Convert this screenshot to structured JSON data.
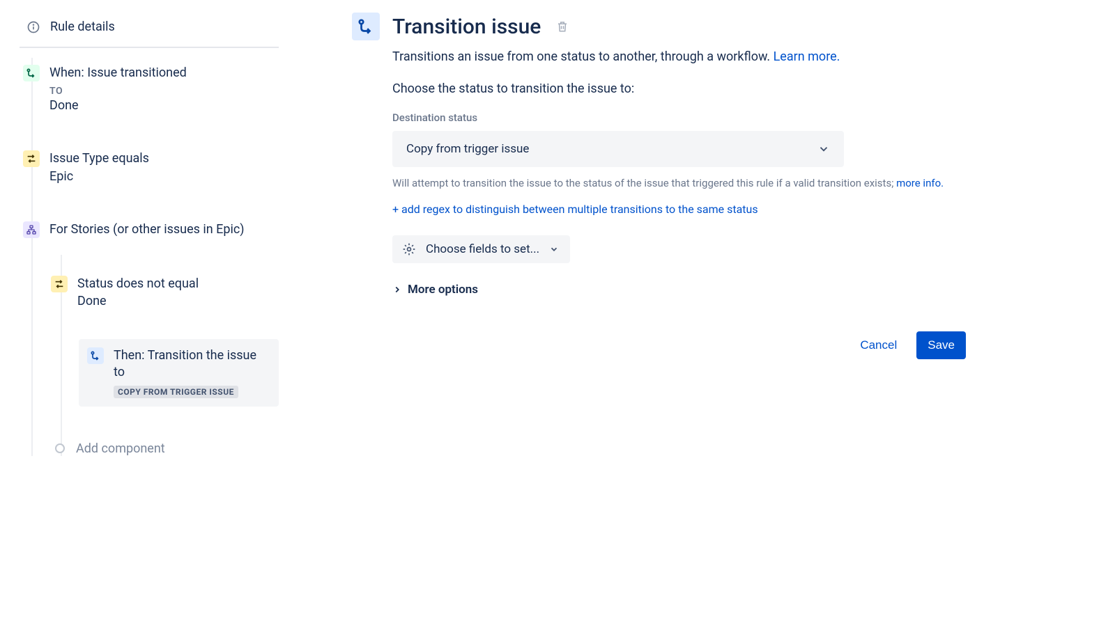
{
  "sidebar": {
    "rule_details_label": "Rule details",
    "nodes": {
      "trigger": {
        "title": "When: Issue transitioned",
        "sub_label": "TO",
        "value": "Done"
      },
      "condition1": {
        "title": "Issue Type equals",
        "value": "Epic"
      },
      "branch": {
        "title": "For Stories (or other issues in Epic)"
      },
      "condition2": {
        "title": "Status does not equal",
        "value": "Done"
      },
      "action": {
        "title": "Then: Transition the issue to",
        "lozenge": "COPY FROM TRIGGER ISSUE"
      }
    },
    "add_component_label": "Add component"
  },
  "main": {
    "title": "Transition issue",
    "description_pre": "Transitions an issue from one status to another, through a workflow. ",
    "learn_more": "Learn more.",
    "prompt": "Choose the status to transition the issue to:",
    "destination_label": "Destination status",
    "destination_value": "Copy from trigger issue",
    "help_text_pre": "Will attempt to transition the issue to the status of the issue that triggered this rule if a valid transition exists; ",
    "more_info": "more info.",
    "add_regex": "+ add regex to distinguish between multiple transitions to the same status",
    "choose_fields": "Choose fields to set...",
    "more_options": "More options",
    "cancel": "Cancel",
    "save": "Save"
  }
}
